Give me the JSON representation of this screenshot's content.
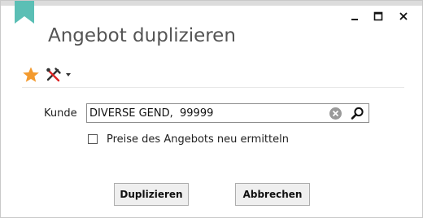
{
  "window": {
    "title": "Angebot duplizieren",
    "accent_color": "#5bbfb5"
  },
  "titlebar": {
    "minimize_icon": "minimize-icon",
    "maximize_icon": "maximize-icon",
    "close_icon": "close-icon"
  },
  "toolbar": {
    "favorite_icon": "star-icon",
    "favorite_color": "#f39a2e",
    "tools_icon": "tools-icon"
  },
  "form": {
    "kunde_label": "Kunde",
    "kunde_value": "DIVERSE GEND,  99999",
    "recalc_label": "Preise des Angebots neu ermitteln",
    "recalc_checked": false
  },
  "actions": {
    "duplicate_label": "Duplizieren",
    "cancel_label": "Abbrechen"
  }
}
